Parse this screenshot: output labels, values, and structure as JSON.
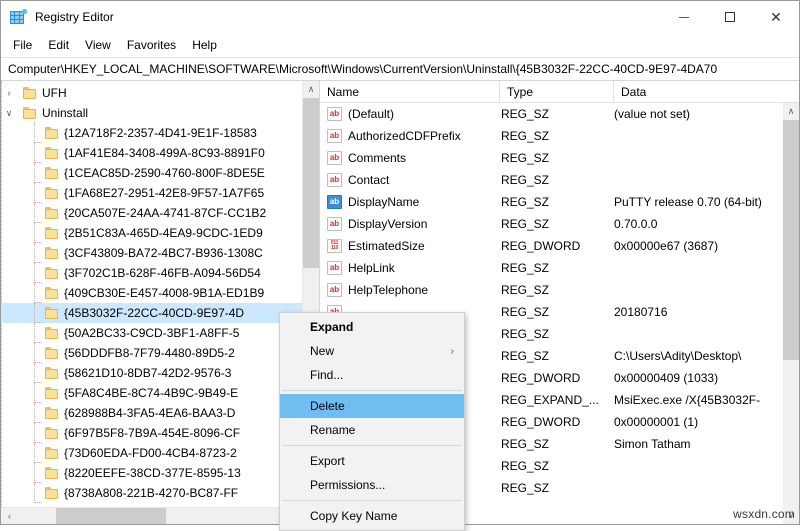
{
  "window": {
    "title": "Registry Editor",
    "icon": "registry-app-icon",
    "controls": {
      "minimize": "—",
      "maximize": "❐",
      "close": "✕"
    }
  },
  "menubar": {
    "items": [
      "File",
      "Edit",
      "View",
      "Favorites",
      "Help"
    ]
  },
  "addressbar": {
    "path": "Computer\\HKEY_LOCAL_MACHINE\\SOFTWARE\\Microsoft\\Windows\\CurrentVersion\\Uninstall\\{45B3032F-22CC-40CD-9E97-4DA70"
  },
  "tree": {
    "items": [
      {
        "label": "UFH",
        "level": 1,
        "chevron": "›",
        "selected": false
      },
      {
        "label": "Uninstall",
        "level": 1,
        "chevron": "∨",
        "selected": false
      },
      {
        "label": "{12A718F2-2357-4D41-9E1F-18583",
        "level": 2,
        "chevron": "",
        "selected": false
      },
      {
        "label": "{1AF41E84-3408-499A-8C93-8891F0",
        "level": 2,
        "chevron": "",
        "selected": false
      },
      {
        "label": "{1CEAC85D-2590-4760-800F-8DE5E",
        "level": 2,
        "chevron": "",
        "selected": false
      },
      {
        "label": "{1FA68E27-2951-42E8-9F57-1A7F65",
        "level": 2,
        "chevron": "",
        "selected": false
      },
      {
        "label": "{20CA507E-24AA-4741-87CF-CC1B2",
        "level": 2,
        "chevron": "",
        "selected": false
      },
      {
        "label": "{2B51C83A-465D-4EA9-9CDC-1ED9",
        "level": 2,
        "chevron": "",
        "selected": false
      },
      {
        "label": "{3CF43809-BA72-4BC7-B936-1308C",
        "level": 2,
        "chevron": "",
        "selected": false
      },
      {
        "label": "{3F702C1B-628F-46FB-A094-56D54",
        "level": 2,
        "chevron": "",
        "selected": false
      },
      {
        "label": "{409CB30E-E457-4008-9B1A-ED1B9",
        "level": 2,
        "chevron": "",
        "selected": false
      },
      {
        "label": "{45B3032F-22CC-40CD-9E97-4D",
        "level": 2,
        "chevron": "",
        "selected": true
      },
      {
        "label": "{50A2BC33-C9CD-3BF1-A8FF-5",
        "level": 2,
        "chevron": "",
        "selected": false
      },
      {
        "label": "{56DDDFB8-7F79-4480-89D5-2",
        "level": 2,
        "chevron": "",
        "selected": false
      },
      {
        "label": "{58621D10-8DB7-42D2-9576-3",
        "level": 2,
        "chevron": "",
        "selected": false
      },
      {
        "label": "{5FA8C4BE-8C74-4B9C-9B49-E",
        "level": 2,
        "chevron": "",
        "selected": false
      },
      {
        "label": "{628988B4-3FA5-4EA6-BAA3-D",
        "level": 2,
        "chevron": "",
        "selected": false
      },
      {
        "label": "{6F97B5F8-7B9A-454E-8096-CF",
        "level": 2,
        "chevron": "",
        "selected": false
      },
      {
        "label": "{73D60EDA-FD00-4CB4-8723-2",
        "level": 2,
        "chevron": "",
        "selected": false
      },
      {
        "label": "{8220EEFE-38CD-377E-8595-13",
        "level": 2,
        "chevron": "",
        "selected": false
      },
      {
        "label": "{8738A808-221B-4270-BC87-FF",
        "level": 2,
        "chevron": "",
        "selected": false
      }
    ],
    "hscroll": {
      "left_arrow": "‹",
      "right_arrow": "›"
    },
    "vscroll": {
      "up_arrow": "∧",
      "down_arrow": "∨"
    }
  },
  "listview": {
    "columns": [
      "Name",
      "Type",
      "Data"
    ],
    "rows": [
      {
        "name": "(Default)",
        "icon": "string-value-icon",
        "type": "REG_SZ",
        "data": "(value not set)"
      },
      {
        "name": "AuthorizedCDFPrefix",
        "icon": "string-value-icon",
        "type": "REG_SZ",
        "data": ""
      },
      {
        "name": "Comments",
        "icon": "string-value-icon",
        "type": "REG_SZ",
        "data": ""
      },
      {
        "name": "Contact",
        "icon": "string-value-icon",
        "type": "REG_SZ",
        "data": ""
      },
      {
        "name": "DisplayName",
        "icon": "string-value-icon-selected",
        "type": "REG_SZ",
        "data": "PuTTY release 0.70 (64-bit)"
      },
      {
        "name": "DisplayVersion",
        "icon": "string-value-icon",
        "type": "REG_SZ",
        "data": "0.70.0.0"
      },
      {
        "name": "EstimatedSize",
        "icon": "dword-value-icon",
        "type": "REG_DWORD",
        "data": "0x00000e67 (3687)"
      },
      {
        "name": "HelpLink",
        "icon": "string-value-icon",
        "type": "REG_SZ",
        "data": ""
      },
      {
        "name": "HelpTelephone",
        "icon": "string-value-icon",
        "type": "REG_SZ",
        "data": ""
      },
      {
        "name": "",
        "icon": "string-value-icon",
        "type": "REG_SZ",
        "data": "20180716"
      },
      {
        "name": "",
        "icon": "string-value-icon",
        "type": "REG_SZ",
        "data": ""
      },
      {
        "name": "",
        "icon": "string-value-icon",
        "type": "REG_SZ",
        "data": "C:\\Users\\Adity\\Desktop\\"
      },
      {
        "name": "",
        "icon": "dword-value-icon",
        "type": "REG_DWORD",
        "data": "0x00000409 (1033)"
      },
      {
        "name": "",
        "icon": "expand-value-icon",
        "type": "REG_EXPAND_...",
        "data": "MsiExec.exe /X{45B3032F-"
      },
      {
        "name": "",
        "icon": "dword-value-icon",
        "type": "REG_DWORD",
        "data": "0x00000001 (1)"
      },
      {
        "name": "",
        "icon": "string-value-icon",
        "type": "REG_SZ",
        "data": "Simon Tatham"
      },
      {
        "name": "",
        "icon": "string-value-icon",
        "type": "REG_SZ",
        "data": ""
      },
      {
        "name": "",
        "icon": "string-value-icon",
        "type": "REG_SZ",
        "data": ""
      }
    ],
    "vscroll": {
      "up_arrow": "∧",
      "down_arrow": "∨"
    }
  },
  "context_menu": {
    "items": [
      {
        "label": "Expand",
        "bold": true,
        "highlight": false,
        "submenu": false,
        "separator_after": false
      },
      {
        "label": "New",
        "bold": false,
        "highlight": false,
        "submenu": true,
        "separator_after": false
      },
      {
        "label": "Find...",
        "bold": false,
        "highlight": false,
        "submenu": false,
        "separator_after": true
      },
      {
        "label": "Delete",
        "bold": false,
        "highlight": true,
        "submenu": false,
        "separator_after": false
      },
      {
        "label": "Rename",
        "bold": false,
        "highlight": false,
        "submenu": false,
        "separator_after": true
      },
      {
        "label": "Export",
        "bold": false,
        "highlight": false,
        "submenu": false,
        "separator_after": false
      },
      {
        "label": "Permissions...",
        "bold": false,
        "highlight": false,
        "submenu": false,
        "separator_after": true
      },
      {
        "label": "Copy Key Name",
        "bold": false,
        "highlight": false,
        "submenu": false,
        "separator_after": false
      }
    ],
    "submenu_arrow": "›"
  },
  "watermark": {
    "text": "wsxdn.com"
  },
  "colors": {
    "selection": "#cce8ff",
    "menu_highlight": "#70bdf2",
    "folder": "#fbe09b",
    "string_icon": "#d1342f",
    "selected_icon": "#3b8fd4"
  }
}
